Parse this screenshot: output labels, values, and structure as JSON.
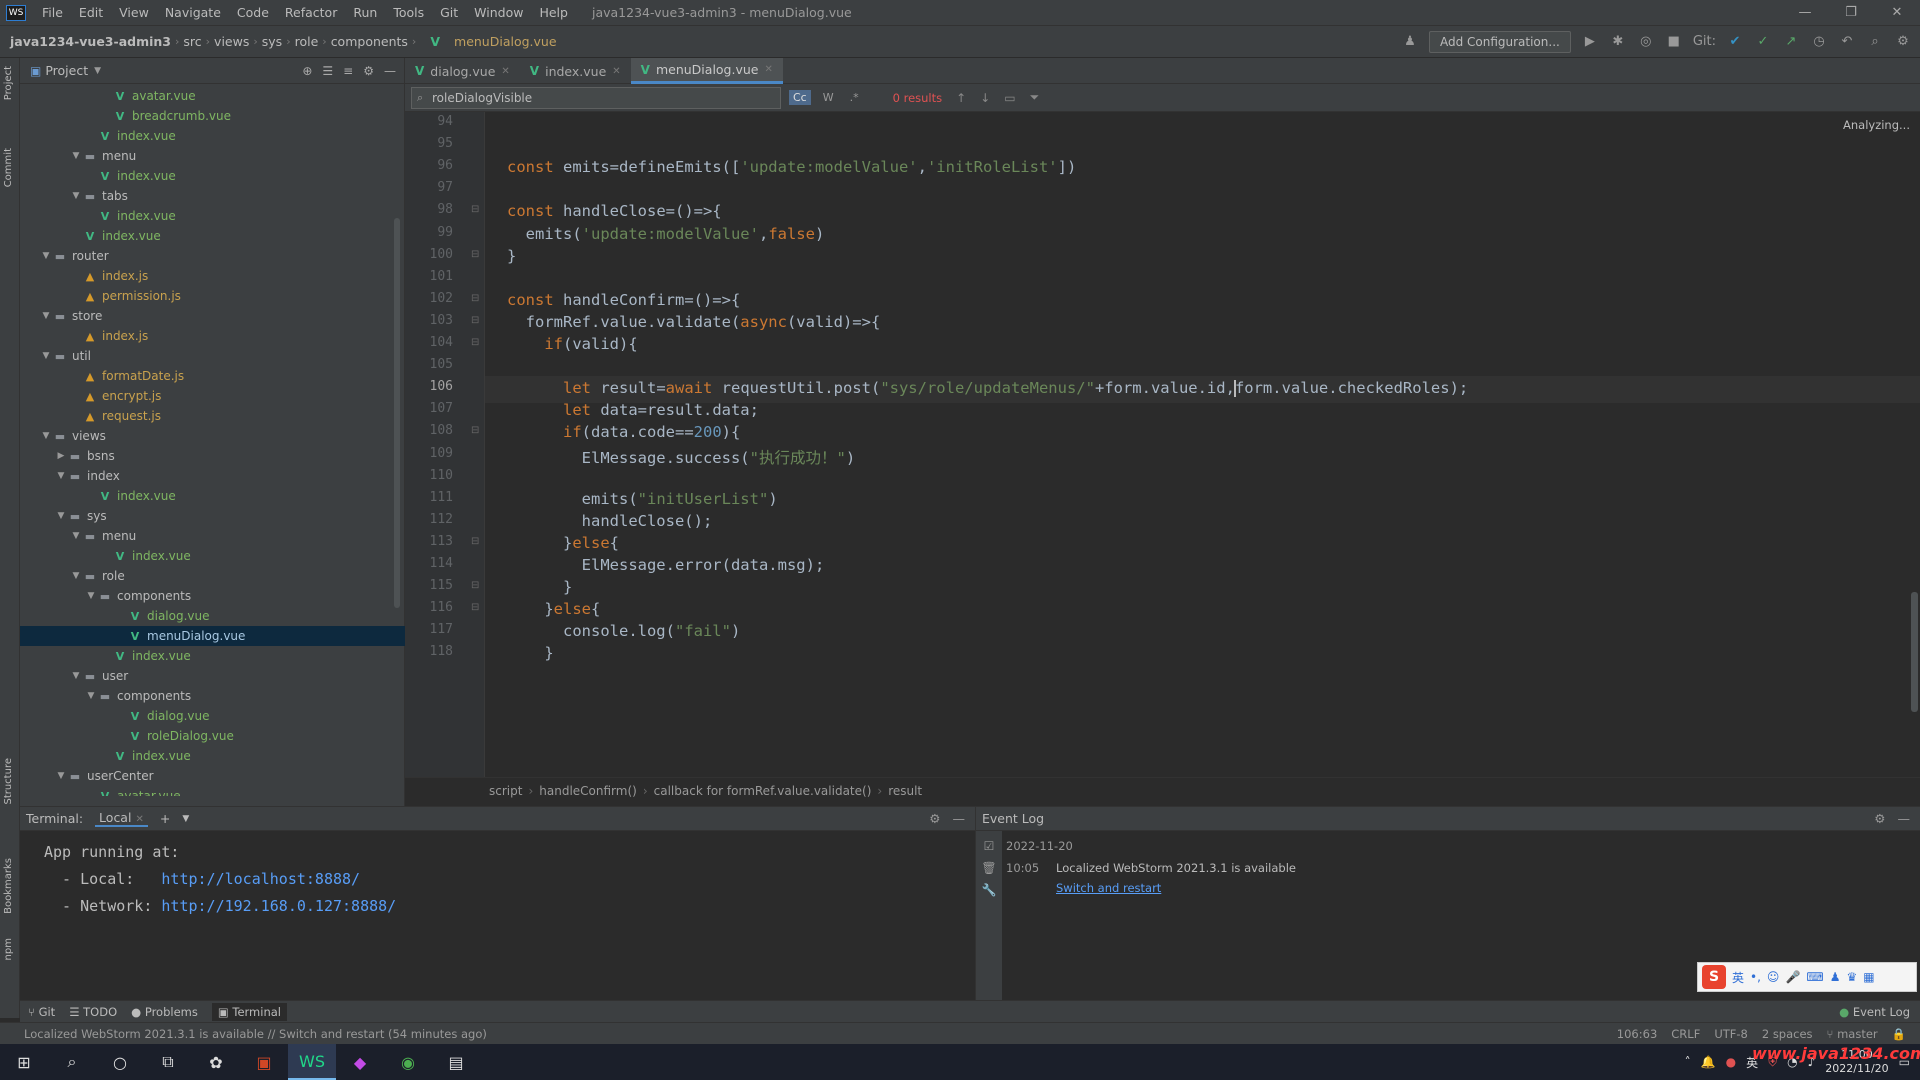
{
  "menubar": {
    "items": [
      "File",
      "Edit",
      "View",
      "Navigate",
      "Code",
      "Refactor",
      "Run",
      "Tools",
      "Git",
      "Window",
      "Help"
    ],
    "window_title": "java1234-vue3-admin3 - menuDialog.vue"
  },
  "navbar": {
    "crumbs": [
      "java1234-vue3-admin3",
      "src",
      "views",
      "sys",
      "role",
      "components"
    ],
    "file": "menuDialog.vue",
    "add_config": "Add Configuration...",
    "git_label": "Git:"
  },
  "project": {
    "title": "Project",
    "tree": [
      {
        "depth": 6,
        "type": "vue",
        "label": "avatar.vue"
      },
      {
        "depth": 6,
        "type": "vue",
        "label": "breadcrumb.vue"
      },
      {
        "depth": 5,
        "type": "vue",
        "label": "index.vue"
      },
      {
        "depth": 4,
        "type": "folder",
        "open": true,
        "label": "menu"
      },
      {
        "depth": 5,
        "type": "vue",
        "label": "index.vue"
      },
      {
        "depth": 4,
        "type": "folder",
        "open": true,
        "label": "tabs"
      },
      {
        "depth": 5,
        "type": "vue",
        "label": "index.vue"
      },
      {
        "depth": 4,
        "type": "vue",
        "label": "index.vue"
      },
      {
        "depth": 2,
        "type": "folder",
        "open": true,
        "label": "router"
      },
      {
        "depth": 4,
        "type": "js",
        "label": "index.js"
      },
      {
        "depth": 4,
        "type": "js",
        "label": "permission.js"
      },
      {
        "depth": 2,
        "type": "folder",
        "open": true,
        "label": "store"
      },
      {
        "depth": 4,
        "type": "js",
        "label": "index.js"
      },
      {
        "depth": 2,
        "type": "folder",
        "open": true,
        "label": "util"
      },
      {
        "depth": 4,
        "type": "js",
        "label": "formatDate.js"
      },
      {
        "depth": 4,
        "type": "js",
        "label": "encrypt.js"
      },
      {
        "depth": 4,
        "type": "js",
        "label": "request.js"
      },
      {
        "depth": 2,
        "type": "folder",
        "open": true,
        "label": "views"
      },
      {
        "depth": 3,
        "type": "folder",
        "open": false,
        "label": "bsns"
      },
      {
        "depth": 3,
        "type": "folder",
        "open": true,
        "label": "index"
      },
      {
        "depth": 5,
        "type": "vue",
        "label": "index.vue"
      },
      {
        "depth": 3,
        "type": "folder",
        "open": true,
        "label": "sys"
      },
      {
        "depth": 4,
        "type": "folder",
        "open": true,
        "label": "menu"
      },
      {
        "depth": 6,
        "type": "vue",
        "label": "index.vue"
      },
      {
        "depth": 4,
        "type": "folder",
        "open": true,
        "label": "role"
      },
      {
        "depth": 5,
        "type": "folder",
        "open": true,
        "label": "components"
      },
      {
        "depth": 7,
        "type": "vue",
        "label": "dialog.vue"
      },
      {
        "depth": 7,
        "type": "vue",
        "label": "menuDialog.vue",
        "selected": true
      },
      {
        "depth": 6,
        "type": "vue",
        "label": "index.vue"
      },
      {
        "depth": 4,
        "type": "folder",
        "open": true,
        "label": "user"
      },
      {
        "depth": 5,
        "type": "folder",
        "open": true,
        "label": "components"
      },
      {
        "depth": 7,
        "type": "vue",
        "label": "dialog.vue"
      },
      {
        "depth": 7,
        "type": "vue",
        "label": "roleDialog.vue"
      },
      {
        "depth": 6,
        "type": "vue",
        "label": "index.vue"
      },
      {
        "depth": 3,
        "type": "folder",
        "open": true,
        "label": "userCenter"
      },
      {
        "depth": 5,
        "type": "vue",
        "label": "avatar.vue"
      }
    ]
  },
  "tabs": [
    {
      "label": "dialog.vue",
      "active": false
    },
    {
      "label": "index.vue",
      "active": false
    },
    {
      "label": "menuDialog.vue",
      "active": true
    }
  ],
  "findbar": {
    "value": "roleDialogVisible",
    "opt_case": "Cc",
    "opt_word": "W",
    "results": "0 results"
  },
  "editor": {
    "status": "Analyzing...",
    "current_line": 106,
    "lines": [
      {
        "n": 94,
        "code": ""
      },
      {
        "n": 95,
        "code": ""
      },
      {
        "n": 96,
        "code": "<kw>const</kw> emits=defineEmits([<str>'update:modelValue'</str>,<str>'initRoleList'</str>])"
      },
      {
        "n": 97,
        "code": ""
      },
      {
        "n": 98,
        "code": "<kw>const</kw> handleClose=()=>{",
        "fold": true
      },
      {
        "n": 99,
        "code": "  emits(<str>'update:modelValue'</str>,<kw>false</kw>)"
      },
      {
        "n": 100,
        "code": "}",
        "fold": true
      },
      {
        "n": 101,
        "code": ""
      },
      {
        "n": 102,
        "code": "<kw>const</kw> handleConfirm=()=>{",
        "fold": true
      },
      {
        "n": 103,
        "code": "  formRef.value.validate(<kw>async</kw>(valid)=>{",
        "fold": true
      },
      {
        "n": 104,
        "code": "    <kw>if</kw>(valid){",
        "fold": true
      },
      {
        "n": 105,
        "code": ""
      },
      {
        "n": 106,
        "code": "      <kw>let</kw> result=<kw>await</kw> requestUtil.post(<str>\"sys/role/updateMenus/\"</str>+form.value.id,<caret>form.value.checkedRoles);"
      },
      {
        "n": 107,
        "code": "      <kw>let</kw> data=result.data;"
      },
      {
        "n": 108,
        "code": "      <kw>if</kw>(data.code==<num>200</num>){",
        "fold": true
      },
      {
        "n": 109,
        "code": "        ElMessage.success(<str>\"执行成功！\"</str>)"
      },
      {
        "n": 110,
        "code": ""
      },
      {
        "n": 111,
        "code": "        emits(<str>\"initUserList\"</str>)"
      },
      {
        "n": 112,
        "code": "        handleClose();"
      },
      {
        "n": 113,
        "code": "      }<kw>else</kw>{",
        "fold": true
      },
      {
        "n": 114,
        "code": "        ElMessage.error(data.msg);"
      },
      {
        "n": 115,
        "code": "      }",
        "fold": true
      },
      {
        "n": 116,
        "code": "    }<kw>else</kw>{",
        "fold": true
      },
      {
        "n": 117,
        "code": "      console.log(<str>\"fail\"</str>)"
      },
      {
        "n": 118,
        "code": "    }"
      }
    ]
  },
  "edcrumb": [
    "script",
    "handleConfirm()",
    "callback for formRef.value.validate()",
    "result"
  ],
  "terminal": {
    "title": "Terminal:",
    "tab": "Local",
    "line1": "App running at:",
    "local_label": "  - Local:   ",
    "local_url": "http://localhost:8888/",
    "network_label": "  - Network: ",
    "network_url": "http://192.168.0.127:8888/"
  },
  "eventlog": {
    "title": "Event Log",
    "date": "2022-11-20",
    "time": "10:05",
    "message": "Localized WebStorm 2021.3.1 is available",
    "link": "Switch and restart"
  },
  "tooltabs": {
    "items": [
      "Git",
      "TODO",
      "Problems",
      "Terminal"
    ],
    "active": "Terminal",
    "right": "Event Log"
  },
  "statusbar": {
    "message": "Localized WebStorm 2021.3.1 is available // Switch and restart (54 minutes ago)",
    "position": "106:63",
    "line_sep": "CRLF",
    "encoding": "UTF-8",
    "indent": "2 spaces",
    "branch": "master"
  },
  "taskbar": {
    "time": "11:00",
    "date": "2022/11/20",
    "ime_lang": "英",
    "tray_lang": "英"
  },
  "watermark": "www.java1234.com"
}
